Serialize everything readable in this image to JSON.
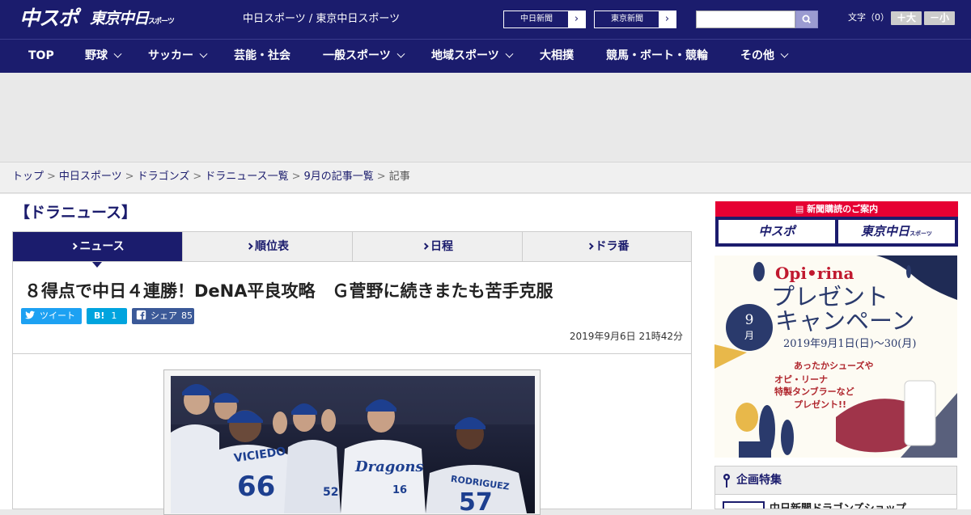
{
  "header": {
    "logo_main": "中スポ",
    "logo_tokyo": "東京中日",
    "logo_tokyo_small": "スポーツ",
    "site_title": "中日スポーツ / 東京中日スポーツ",
    "ext_links": [
      "中日新聞",
      "東京新聞"
    ],
    "font_label": "文字（0）",
    "font_larger": "＋大",
    "font_smaller": "－小"
  },
  "nav": {
    "items": [
      {
        "label": "TOP",
        "dropdown": false
      },
      {
        "label": "野球",
        "dropdown": true
      },
      {
        "label": "サッカー",
        "dropdown": true
      },
      {
        "label": "芸能・社会",
        "dropdown": false
      },
      {
        "label": "一般スポーツ",
        "dropdown": true
      },
      {
        "label": "地域スポーツ",
        "dropdown": true
      },
      {
        "label": "大相撲",
        "dropdown": false
      },
      {
        "label": "競馬・ボート・競輪",
        "dropdown": false
      },
      {
        "label": "その他",
        "dropdown": true
      }
    ]
  },
  "breadcrumb": {
    "items": [
      "トップ",
      "中日スポーツ",
      "ドラゴンズ",
      "ドラニュース一覧",
      "9月の記事一覧",
      "記事"
    ],
    "separator": ">"
  },
  "section_title": "【ドラニュース】",
  "tabs": [
    "ニュース",
    "順位表",
    "日程",
    "ドラ番"
  ],
  "article": {
    "headline": "８得点で中日４連勝！DeNA平良攻略　Ｇ菅野に続きまたも苦手克服",
    "share": {
      "tweet_label": "ツイート",
      "hatena_label": "B!",
      "hatena_count": "1",
      "facebook_label": "シェア",
      "facebook_count": "85"
    },
    "timestamp": "2019年9月6日 21時42分"
  },
  "photo": {
    "jersey_names": [
      "VICIEDO",
      "RODRIGUEZ"
    ],
    "jersey_numbers": [
      "66",
      "52",
      "16",
      "57"
    ],
    "team_script": "Dragons"
  },
  "sidebar": {
    "subscription_header": "新聞購読のご案内",
    "subscription_links": [
      "中スポ",
      "東京中日"
    ],
    "subscription_link_small": "スポーツ",
    "promo": {
      "brand": "Opi•rina",
      "title_line1": "プレゼント",
      "title_line2": "キャンペーン",
      "date_range": "2019年9月1日(日)〜30(月)",
      "month_number": "9",
      "month_unit": "月",
      "line1": "あったかシューズや",
      "line2": "オピ・リーナ",
      "line3": "特製タンブラーなど",
      "line4": "プレゼント!!"
    },
    "feature_title": "企画特集",
    "feature_item": "中日新聞ドラゴンズショップ"
  },
  "colors": {
    "brand_navy": "#1b1c6d",
    "accent_red": "#e60033",
    "twitter": "#1da1f2",
    "hatena": "#00a4de",
    "facebook": "#3b5998"
  }
}
